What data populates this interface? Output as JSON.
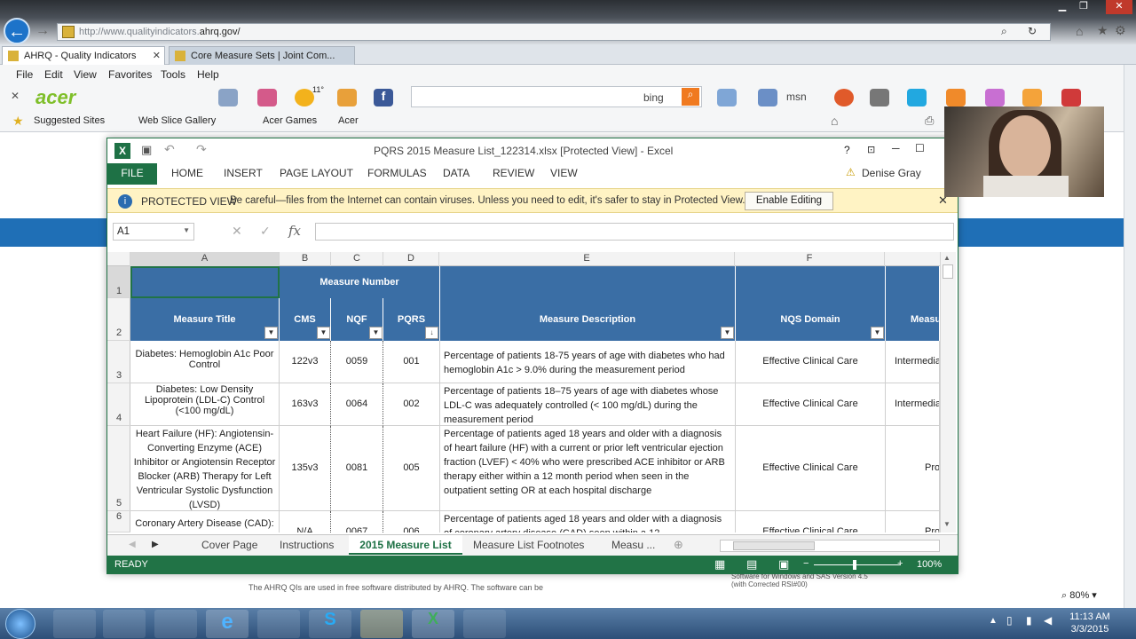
{
  "browser": {
    "address_prefix": "http://www.qualityindicators.",
    "address_host": "ahrq.gov/",
    "tabs": [
      {
        "label": "AHRQ - Quality Indicators",
        "active": true
      },
      {
        "label": "Core Measure Sets | Joint Com...",
        "active": false
      }
    ],
    "menu": [
      "File",
      "Edit",
      "View",
      "Favorites",
      "Tools",
      "Help"
    ],
    "toolbar": {
      "brand": "acer",
      "search_engine": "bing",
      "weather_temp": "11°"
    },
    "favorites": [
      "Suggested Sites",
      "Web Slice Gallery",
      "Acer Games",
      "Acer"
    ],
    "page_text": "The AHRQ QIs are used in free software distributed by AHRQ. The software can be",
    "page_text_right": "Software for Windows and SAS Version 4.5 (with Corrected RSI#00)",
    "zoom": "80%"
  },
  "excel": {
    "title": "PQRS 2015 Measure List_122314.xlsx  [Protected View] - Excel",
    "ribbon_tabs": [
      "FILE",
      "HOME",
      "INSERT",
      "PAGE LAYOUT",
      "FORMULAS",
      "DATA",
      "REVIEW",
      "VIEW"
    ],
    "user": "Denise Gray",
    "protected_view": {
      "title": "PROTECTED VIEW",
      "message": "Be careful—files from the Internet can contain viruses. Unless you need to edit, it's safer to stay in Protected View.",
      "button": "Enable Editing"
    },
    "namebox": "A1",
    "fx": "fx",
    "columns": [
      "A",
      "B",
      "C",
      "D",
      "E",
      "F"
    ],
    "header_row1": {
      "measure_number": "Measure Number"
    },
    "headers": {
      "measure_title": "Measure Title",
      "cms": "CMS",
      "nqf": "NQF",
      "pqrs": "PQRS",
      "description": "Measure Description",
      "nqs_domain": "NQS Domain",
      "next": "Measu"
    },
    "rows": [
      {
        "num": "3",
        "title": "Diabetes: Hemoglobin A1c Poor Control",
        "cms": "122v3",
        "nqf": "0059",
        "pqrs": "001",
        "desc": "Percentage of patients 18-75 years of age with diabetes who had hemoglobin A1c > 9.0% during the measurement period",
        "domain": "Effective Clinical Care",
        "next": "Intermedia"
      },
      {
        "num": "4",
        "title": "Diabetes: Low Density Lipoprotein (LDL-C) Control (<100 mg/dL)",
        "cms": "163v3",
        "nqf": "0064",
        "pqrs": "002",
        "desc": "Percentage of patients 18–75 years of age with diabetes whose LDL-C was adequately controlled (< 100 mg/dL) during the measurement period",
        "domain": "Effective Clinical Care",
        "next": "Intermedia"
      },
      {
        "num": "5",
        "title": "Heart Failure (HF): Angiotensin-Converting Enzyme (ACE) Inhibitor or Angiotensin Receptor Blocker (ARB) Therapy for Left Ventricular Systolic Dysfunction (LVSD)",
        "cms": "135v3",
        "nqf": "0081",
        "pqrs": "005",
        "desc": "Percentage of patients aged 18 years and older with a diagnosis of heart failure (HF) with a current or prior left ventricular ejection fraction (LVEF) < 40% who were prescribed ACE inhibitor or ARB therapy either within a 12 month period when seen in the outpatient setting OR at each hospital discharge",
        "domain": "Effective Clinical Care",
        "next": "Pro"
      },
      {
        "num": "6",
        "title": "Coronary Artery Disease (CAD):",
        "cms": "N/A",
        "nqf": "0067",
        "pqrs": "006",
        "desc": "Percentage of patients aged 18 years and older with a diagnosis of coronary artery disease (CAD) seen within a 12",
        "domain": "Effective Clinical Care",
        "next": "Pro"
      }
    ],
    "sheets": [
      "Cover Page",
      "Instructions",
      "2015 Measure List",
      "Measure List Footnotes",
      "Measu ..."
    ],
    "status": "READY",
    "zoom": "100%"
  },
  "taskbar": {
    "time": "11:13 AM",
    "date": "3/3/2015"
  }
}
